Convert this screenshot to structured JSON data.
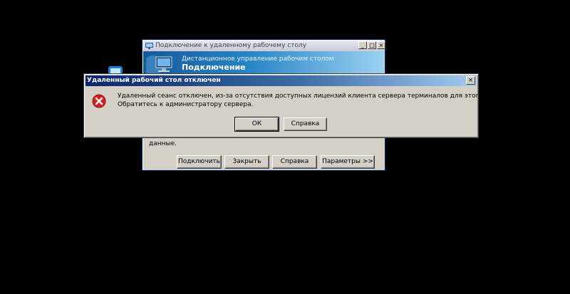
{
  "background_window": {
    "title": "Подключение к удаленному рабочему столу",
    "banner_subtitle": "Дистанционное управление рабочим столом",
    "banner_title": "Подключение",
    "body_partial_text": "данные.",
    "buttons": {
      "connect": "Подключить",
      "close": "Закрыть",
      "help": "Справка",
      "options": "Параметры >>"
    },
    "title_controls": {
      "minimize": "_",
      "maximize": "□",
      "close": "×"
    }
  },
  "error_dialog": {
    "title": "Удаленный рабочий стол отключен",
    "close_glyph": "×",
    "message_line1": "Удаленный сеанс отключен, из-за отсутствия доступных лицензий клиента сервера терминалов для этого компьютера.",
    "message_line2": "Обратитесь к администратору сервера.",
    "ok_label": "ОК",
    "help_label": "Справка",
    "icon": "error-x-icon"
  },
  "colors": {
    "desktop": "#000000",
    "dialog_face": "#d4d0c8",
    "active_title_start": "#0a246a",
    "active_title_end": "#a6caf0",
    "error_red": "#d81e1e"
  }
}
